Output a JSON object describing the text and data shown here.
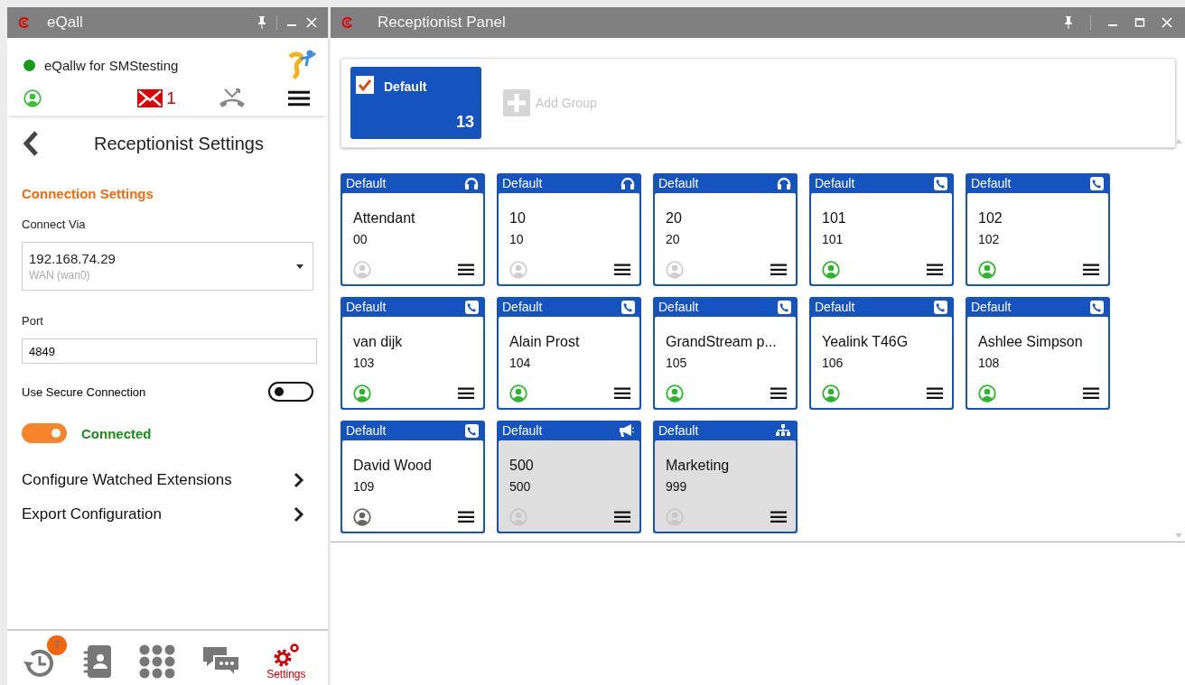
{
  "left_window": {
    "title": "eQall",
    "user": {
      "name": "eQallw for SMStesting",
      "online": true
    },
    "messages_count": "1",
    "page_title": "Receptionist Settings",
    "section_title": "Connection Settings",
    "connect_via": {
      "label": "Connect Via",
      "value": "192.168.74.29",
      "sub": "WAN (wan0)"
    },
    "port": {
      "label": "Port",
      "value": "4849"
    },
    "secure": {
      "label": "Use Secure Connection",
      "on": false
    },
    "connection": {
      "on": true,
      "status": "Connected"
    },
    "links": [
      "Configure Watched Extensions",
      "Export Configuration"
    ],
    "footer": [
      {
        "kind": "history",
        "badge": "7",
        "selected": false
      },
      {
        "kind": "contacts",
        "selected": false
      },
      {
        "kind": "dialpad",
        "selected": false
      },
      {
        "kind": "chat",
        "selected": false
      },
      {
        "kind": "settings",
        "label": "Settings",
        "selected": true
      }
    ]
  },
  "right_window": {
    "title": "Receptionist Panel",
    "groups": [
      {
        "label": "Default",
        "count": "13",
        "checked": true
      }
    ],
    "add_group": "Add Group",
    "extensions": [
      {
        "group": "Default",
        "kind": "headset",
        "name": "Attendant",
        "number": "00",
        "color": "#cfcfcf",
        "disabled": false
      },
      {
        "group": "Default",
        "kind": "headset",
        "name": "10",
        "number": "10",
        "color": "#cfcfcf",
        "disabled": false
      },
      {
        "group": "Default",
        "kind": "headset",
        "name": "20",
        "number": "20",
        "color": "#cfcfcf",
        "disabled": false
      },
      {
        "group": "Default",
        "kind": "phone",
        "name": "101",
        "number": "101",
        "color": "#2bb52b",
        "disabled": false
      },
      {
        "group": "Default",
        "kind": "phone",
        "name": "102",
        "number": "102",
        "color": "#2bb52b",
        "disabled": false
      },
      {
        "group": "Default",
        "kind": "phone",
        "name": "van dijk",
        "number": "103",
        "color": "#2bb52b",
        "disabled": false
      },
      {
        "group": "Default",
        "kind": "phone",
        "name": "Alain Prost",
        "number": "104",
        "color": "#2bb52b",
        "disabled": false
      },
      {
        "group": "Default",
        "kind": "phone",
        "name": "GrandStream p...",
        "number": "105",
        "color": "#2bb52b",
        "disabled": false
      },
      {
        "group": "Default",
        "kind": "phone",
        "name": "Yealink T46G",
        "number": "106",
        "color": "#2bb52b",
        "disabled": false
      },
      {
        "group": "Default",
        "kind": "phone",
        "name": "Ashlee Simpson",
        "number": "108",
        "color": "#2bb52b",
        "disabled": false
      },
      {
        "group": "Default",
        "kind": "phone",
        "name": "David Wood",
        "number": "109",
        "color": "#666666",
        "disabled": false
      },
      {
        "group": "Default",
        "kind": "paging",
        "name": "500",
        "number": "500",
        "color": "#c8c8c8",
        "disabled": true
      },
      {
        "group": "Default",
        "kind": "group",
        "name": "Marketing",
        "number": "999",
        "color": "#c8c8c8",
        "disabled": true
      }
    ]
  }
}
